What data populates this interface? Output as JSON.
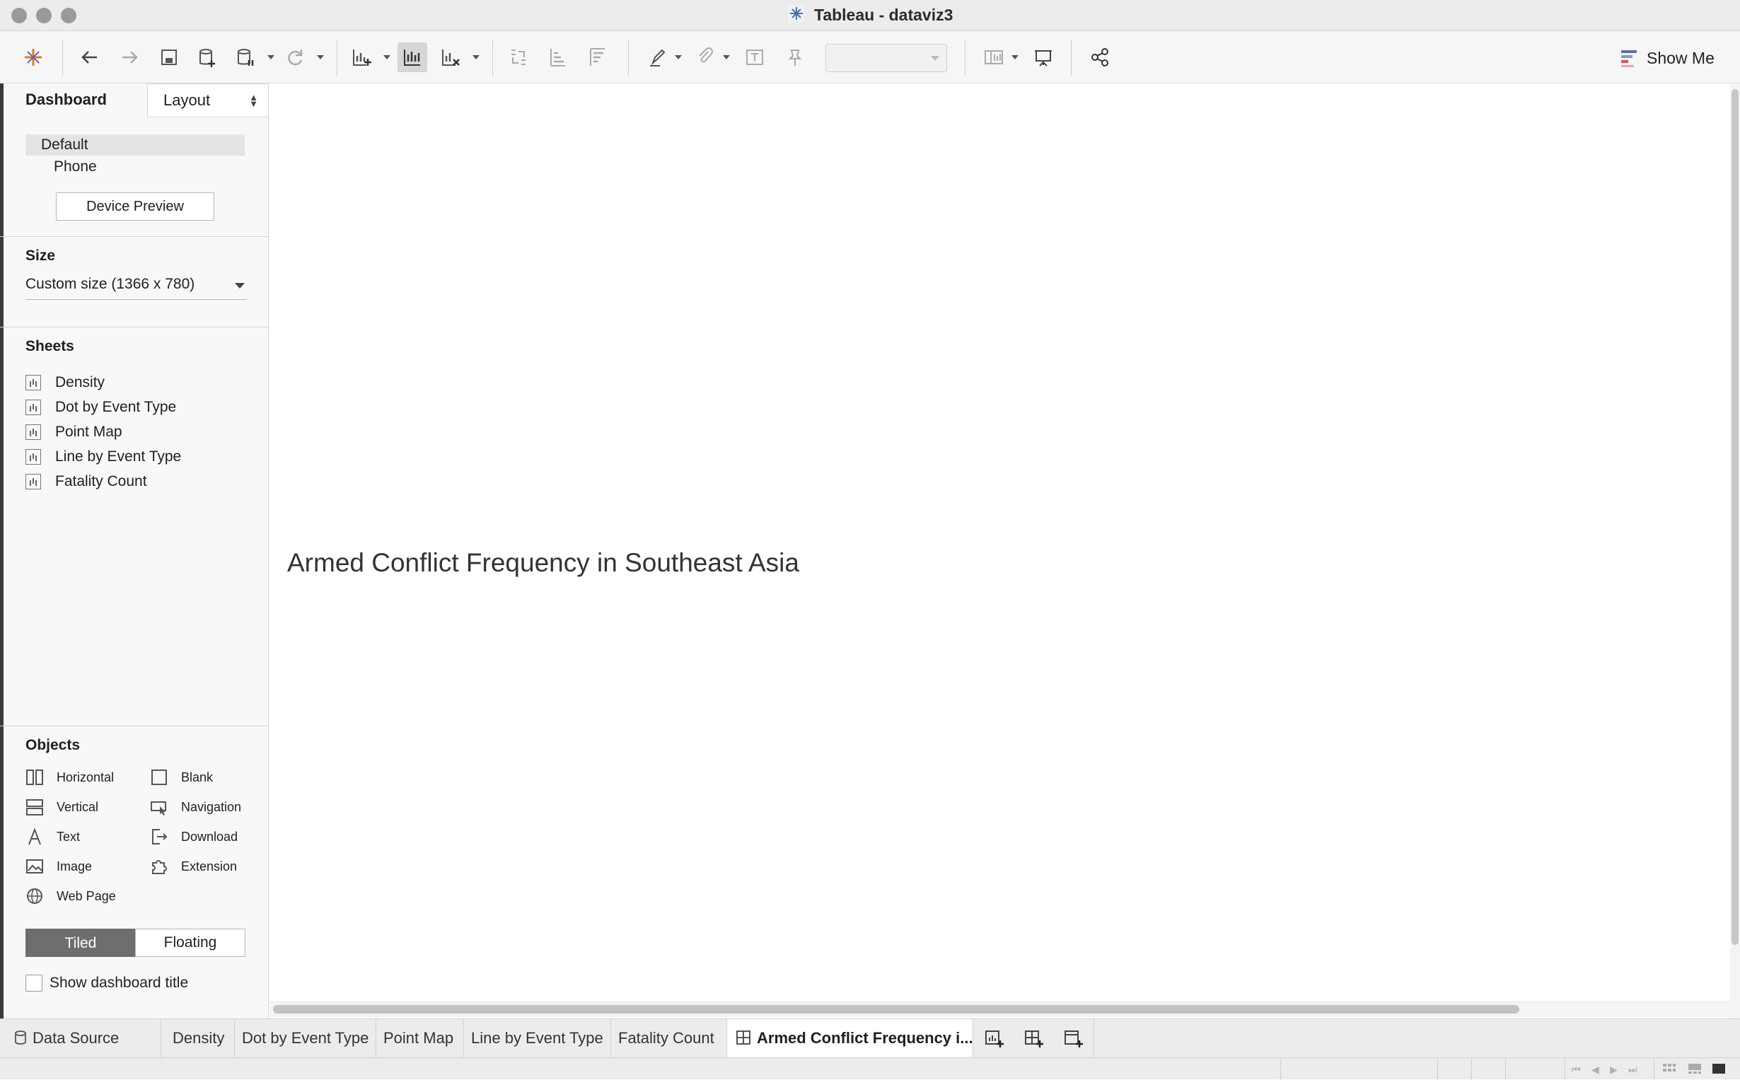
{
  "window": {
    "title": "Tableau - dataviz3"
  },
  "toolbar": {
    "icons": [
      "tableau-logo",
      "undo",
      "redo",
      "save",
      "new-data-source",
      "pause-auto-updates",
      "refresh",
      "new-worksheet",
      "duplicate",
      "clear",
      "swap",
      "sort-ascending",
      "sort-descending",
      "highlight",
      "annotate",
      "show-mark-labels",
      "pin",
      "fit",
      "presentation-mode",
      "show-cards",
      "share"
    ],
    "show_me_label": "Show Me"
  },
  "left_panel": {
    "tabs": {
      "dashboard": "Dashboard",
      "layout": "Layout"
    },
    "devices": {
      "default": "Default",
      "phone": "Phone",
      "preview_button": "Device Preview"
    },
    "size": {
      "heading": "Size",
      "value": "Custom size (1366 x 780)"
    },
    "sheets": {
      "heading": "Sheets",
      "items": [
        "Density",
        "Dot by Event Type",
        "Point Map",
        "Line by Event Type",
        "Fatality Count"
      ]
    },
    "objects": {
      "heading": "Objects",
      "left": [
        "Horizontal",
        "Vertical",
        "Text",
        "Image",
        "Web Page"
      ],
      "right": [
        "Blank",
        "Navigation",
        "Download",
        "Extension"
      ]
    },
    "placement": {
      "tiled": "Tiled",
      "floating": "Floating"
    },
    "show_title_label": "Show dashboard title"
  },
  "canvas": {
    "dashboard_title": "Armed Conflict Frequency in Southeast Asia"
  },
  "bottom_tabs": {
    "data_source": "Data Source",
    "sheets": [
      "Density",
      "Dot by Event Type",
      "Point Map",
      "Line by Event Type",
      "Fatality Count"
    ],
    "active_dashboard": "Armed Conflict Frequency i..."
  }
}
